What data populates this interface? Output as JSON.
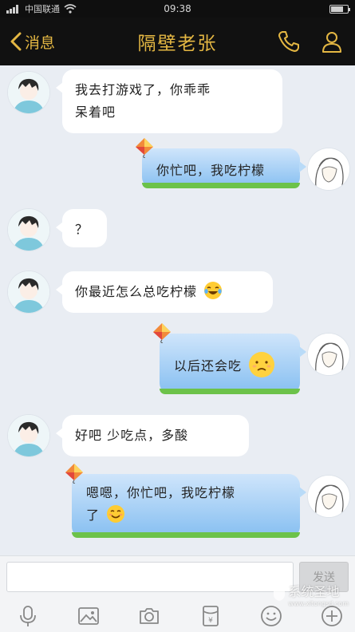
{
  "status_bar": {
    "carrier": "中国联通",
    "time": "09:38",
    "battery_level": 0.75
  },
  "header": {
    "back_label": "消息",
    "title": "隔壁老张",
    "accent_color": "#e4b743"
  },
  "messages": [
    {
      "side": "left",
      "text_line1": "我去打游戏了，你乖乖",
      "text_line2": "呆着吧"
    },
    {
      "side": "right",
      "text": "你忙吧，我吃柠檬"
    },
    {
      "side": "left",
      "text": "？"
    },
    {
      "side": "left",
      "text": "你最近怎么总吃柠檬",
      "emoji": "laughing-tears-emoji"
    },
    {
      "side": "right",
      "text": "以后还会吃",
      "emoji": "sad-face-emoji"
    },
    {
      "side": "left",
      "text": "好吧 少吃点，多酸"
    },
    {
      "side": "right",
      "text_line1": "嗯嗯，你忙吧，我吃柠檬",
      "text_line2": "了",
      "emoji": "smile-emoji"
    }
  ],
  "input": {
    "value": "",
    "send_label": "发送"
  },
  "toolbar_icons": [
    "microphone-icon",
    "image-icon",
    "camera-icon",
    "red-packet-icon",
    "emoji-icon",
    "plus-icon"
  ],
  "watermark": {
    "text": "系统圣地",
    "url": "www.xitongsd.com"
  }
}
